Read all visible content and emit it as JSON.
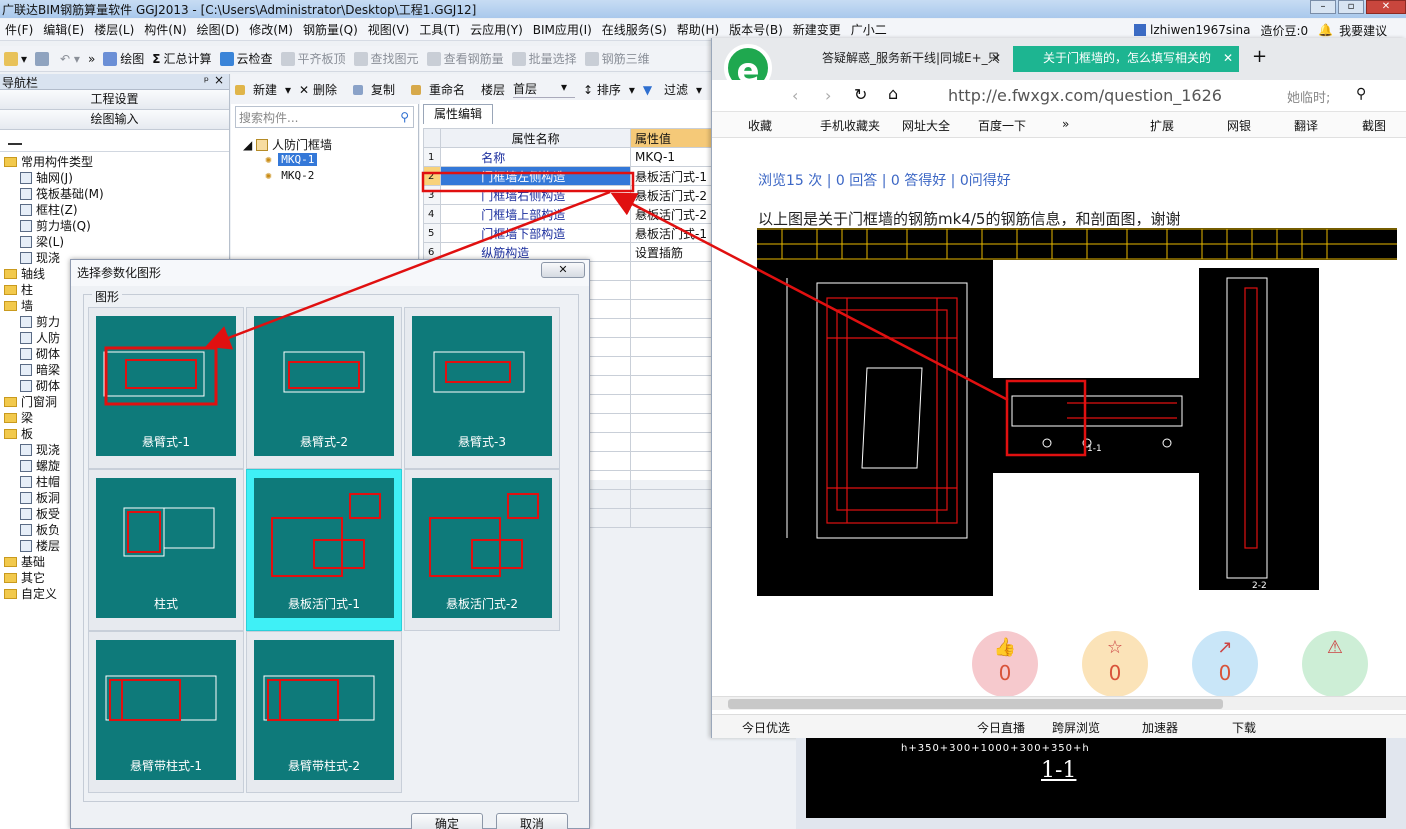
{
  "app": {
    "title": "广联达BIM钢筋算量软件 GGJ2013 - [C:\\Users\\Administrator\\Desktop\\工程1.GGJ12]",
    "user": "lzhiwen1967sina",
    "beans": "造价豆:0",
    "want_build": "我要建议"
  },
  "menu": [
    "件(F)",
    "编辑(E)",
    "楼层(L)",
    "构件(N)",
    "绘图(D)",
    "修改(M)",
    "钢筋量(Q)",
    "视图(V)",
    "工具(T)",
    "云应用(Y)",
    "BIM应用(I)",
    "在线服务(S)",
    "帮助(H)",
    "版本号(B)",
    "新建变更",
    "广小二"
  ],
  "toolbar": [
    "绘图",
    "汇总计算",
    "云检查",
    "平齐板顶",
    "查找图元",
    "查看钢筋量",
    "批量选择",
    "钢筋三维"
  ],
  "nav": {
    "title": "导航栏",
    "pin": "ᵖ",
    "close": "×",
    "btn1": "工程设置",
    "btn2": "绘图输入",
    "tree": [
      {
        "label": "常用构件类型",
        "indent": 0,
        "type": "folder"
      },
      {
        "label": "轴网(J)",
        "indent": 1,
        "type": "item"
      },
      {
        "label": "筏板基础(M)",
        "indent": 1,
        "type": "item"
      },
      {
        "label": "框柱(Z)",
        "indent": 1,
        "type": "item"
      },
      {
        "label": "剪力墙(Q)",
        "indent": 1,
        "type": "item"
      },
      {
        "label": "梁(L)",
        "indent": 1,
        "type": "item"
      },
      {
        "label": "现浇",
        "indent": 1,
        "type": "item"
      },
      {
        "label": "轴线",
        "indent": 0,
        "type": "folder"
      },
      {
        "label": "柱",
        "indent": 0,
        "type": "folder"
      },
      {
        "label": "墙",
        "indent": 0,
        "type": "folder"
      },
      {
        "label": "剪力",
        "indent": 1,
        "type": "item"
      },
      {
        "label": "人防",
        "indent": 1,
        "type": "item"
      },
      {
        "label": "砌体",
        "indent": 1,
        "type": "item"
      },
      {
        "label": "暗梁",
        "indent": 1,
        "type": "item"
      },
      {
        "label": "砌体",
        "indent": 1,
        "type": "item"
      },
      {
        "label": "门窗洞",
        "indent": 0,
        "type": "folder"
      },
      {
        "label": "梁",
        "indent": 0,
        "type": "folder"
      },
      {
        "label": "板",
        "indent": 0,
        "type": "folder"
      },
      {
        "label": "现浇",
        "indent": 1,
        "type": "item"
      },
      {
        "label": "螺旋",
        "indent": 1,
        "type": "item"
      },
      {
        "label": "柱帽",
        "indent": 1,
        "type": "item"
      },
      {
        "label": "板洞",
        "indent": 1,
        "type": "item"
      },
      {
        "label": "板受",
        "indent": 1,
        "type": "item"
      },
      {
        "label": "板负",
        "indent": 1,
        "type": "item"
      },
      {
        "label": "楼层",
        "indent": 1,
        "type": "item"
      },
      {
        "label": "基础",
        "indent": 0,
        "type": "folder"
      },
      {
        "label": "其它",
        "indent": 0,
        "type": "folder"
      },
      {
        "label": "自定义",
        "indent": 0,
        "type": "folder"
      }
    ]
  },
  "mid": {
    "new": "新建",
    "delete": "删除",
    "copy": "复制",
    "rename": "重命名",
    "floor_label": "楼层",
    "floor_value": "首层",
    "sort": "排序",
    "filter": "过滤",
    "search_placeholder": "搜索构件...",
    "tree_root": "人防门框墙",
    "tree_items": [
      "MKQ-1",
      "MKQ-2"
    ]
  },
  "props": {
    "tab": "属性编辑",
    "col_name": "属性名称",
    "col_value": "属性值",
    "rows": [
      {
        "n": "1",
        "name": "名称",
        "value": "MKQ-1"
      },
      {
        "n": "2",
        "name": "门框墙左侧构造",
        "value": "悬板活门式-1"
      },
      {
        "n": "3",
        "name": "门框墙右侧构造",
        "value": "悬板活门式-2"
      },
      {
        "n": "4",
        "name": "门框墙上部构造",
        "value": "悬板活门式-2"
      },
      {
        "n": "5",
        "name": "门框墙下部构造",
        "value": "悬板活门式-1"
      },
      {
        "n": "6",
        "name": "纵筋构造",
        "value": "设置插筋"
      }
    ]
  },
  "dialog": {
    "title": "选择参数化图形",
    "group": "图形",
    "ok": "确定",
    "cancel": "取消",
    "shapes": [
      "悬臂式-1",
      "悬臂式-2",
      "悬臂式-3",
      "柱式",
      "悬板活门式-1",
      "悬板活门式-2",
      "悬臂带柱式-1",
      "悬臂带柱式-2"
    ],
    "selected": "悬板活门式-1"
  },
  "browser": {
    "tab1": "答疑解惑_服务新干线|同城E+_只",
    "tab2": "关于门框墙的，怎么填写相关的",
    "url": "http://e.fwxgx.com/question_1626",
    "search": "她临时;",
    "favs": [
      "收藏",
      "手机收藏夹",
      "网址大全",
      "百度一下",
      "»",
      "扩展",
      "网银",
      "翻译",
      "截图"
    ],
    "stats": "浏览15 次 | 0 回答 | 0 答得好 | 0问得好",
    "question": "以上图是关于门框墙的钢筋mk4/5的钢筋信息，和剖面图，谢谢",
    "actions": [
      {
        "icon": "thumb-up-icon",
        "count": "0",
        "color": "#f6c9cd"
      },
      {
        "icon": "star-icon",
        "count": "0",
        "color": "#fbe3b8"
      },
      {
        "icon": "share-icon",
        "count": "0",
        "color": "#c9e6f8"
      },
      {
        "icon": "warning-icon",
        "count": "",
        "color": "#cdeed6"
      }
    ],
    "status": [
      "今日优选",
      "今日直播",
      "跨屏浏览",
      "加速器",
      "下载"
    ],
    "section_label_1": "1-1",
    "section_label_2": "2-2",
    "dim_text": "h+350+300+1000+300+350+h"
  }
}
